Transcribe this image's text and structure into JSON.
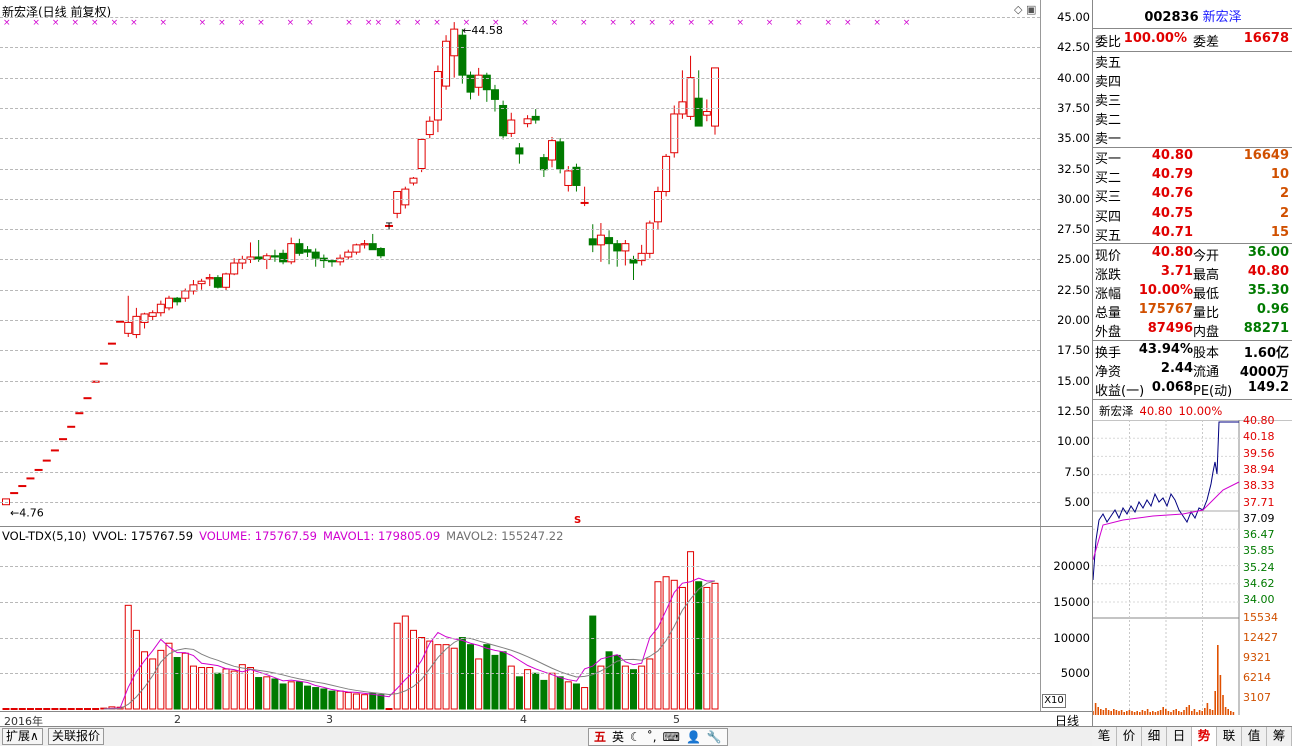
{
  "chart_header": {
    "title": "新宏泽(日线 前复权)"
  },
  "price_axis": {
    "labels": [
      "45.00",
      "42.50",
      "40.00",
      "37.50",
      "35.00",
      "32.50",
      "30.00",
      "27.50",
      "25.00",
      "22.50",
      "20.00",
      "17.50",
      "15.00",
      "12.50",
      "10.00",
      "7.50",
      "5.00"
    ]
  },
  "annotations": {
    "high_label": "44.58",
    "low_label": "4.76",
    "t_mark": "T",
    "s_mark": "S"
  },
  "volume_legend": {
    "name": "VOL-TDX(5,10)",
    "vvol": "VVOL: 175767.59",
    "volume": "VOLUME: 175767.59",
    "mavol1": "MAVOL1: 179805.09",
    "mavol2": "MAVOL2: 155247.22"
  },
  "volume_axis": {
    "labels": [
      "20000",
      "15000",
      "10000",
      "5000"
    ],
    "scale_label": "X10"
  },
  "x_axis": {
    "year_label": "2016年",
    "month_labels": [
      "2",
      "3",
      "4",
      "5"
    ],
    "period": "日线"
  },
  "colors": {
    "up": "#e00000",
    "down": "#007a00",
    "ma1": "#d000d0",
    "ma2": "#808080",
    "grid": "#b8b8b8",
    "avg_line": "#d000d0",
    "price_line": "#000080"
  },
  "chart_data": {
    "type": "candlestick",
    "price_range": [
      4.0,
      46.0
    ],
    "volume_range": [
      0,
      25000
    ],
    "candles": [
      {
        "o": 4.76,
        "h": 5.2,
        "l": 4.76,
        "c": 5.24,
        "v": 0
      },
      {
        "o": 5.76,
        "h": 5.76,
        "l": 5.76,
        "c": 5.76,
        "v": 0
      },
      {
        "o": 6.34,
        "h": 6.34,
        "l": 6.34,
        "c": 6.34,
        "v": 0
      },
      {
        "o": 6.97,
        "h": 6.97,
        "l": 6.97,
        "c": 6.97,
        "v": 0
      },
      {
        "o": 7.67,
        "h": 7.67,
        "l": 7.67,
        "c": 7.67,
        "v": 0
      },
      {
        "o": 8.44,
        "h": 8.44,
        "l": 8.44,
        "c": 8.44,
        "v": 0
      },
      {
        "o": 9.28,
        "h": 9.28,
        "l": 9.28,
        "c": 9.28,
        "v": 0
      },
      {
        "o": 10.21,
        "h": 10.21,
        "l": 10.21,
        "c": 10.21,
        "v": 0
      },
      {
        "o": 11.23,
        "h": 11.23,
        "l": 11.23,
        "c": 11.23,
        "v": 0
      },
      {
        "o": 12.35,
        "h": 12.35,
        "l": 12.35,
        "c": 12.35,
        "v": 0
      },
      {
        "o": 13.59,
        "h": 13.59,
        "l": 13.59,
        "c": 13.59,
        "v": 0
      },
      {
        "o": 14.95,
        "h": 14.95,
        "l": 14.95,
        "c": 14.95,
        "v": 0
      },
      {
        "o": 16.44,
        "h": 16.44,
        "l": 16.44,
        "c": 16.44,
        "v": 120
      },
      {
        "o": 18.09,
        "h": 18.09,
        "l": 18.09,
        "c": 18.09,
        "v": 300
      },
      {
        "o": 19.9,
        "h": 19.9,
        "l": 19.9,
        "c": 19.9,
        "v": 250
      },
      {
        "o": 18.9,
        "h": 22.0,
        "l": 18.6,
        "c": 19.8,
        "v": 14500
      },
      {
        "o": 18.8,
        "h": 21.0,
        "l": 18.5,
        "c": 20.3,
        "v": 11000
      },
      {
        "o": 19.8,
        "h": 20.6,
        "l": 19.3,
        "c": 20.5,
        "v": 8000
      },
      {
        "o": 20.3,
        "h": 20.8,
        "l": 20.0,
        "c": 20.6,
        "v": 7000
      },
      {
        "o": 20.6,
        "h": 21.6,
        "l": 20.3,
        "c": 21.3,
        "v": 8200
      },
      {
        "o": 21.0,
        "h": 22.0,
        "l": 20.8,
        "c": 21.8,
        "v": 9200
      },
      {
        "o": 21.8,
        "h": 21.9,
        "l": 21.2,
        "c": 21.5,
        "v": 7200
      },
      {
        "o": 21.8,
        "h": 22.6,
        "l": 21.5,
        "c": 22.4,
        "v": 7800
      },
      {
        "o": 22.4,
        "h": 23.3,
        "l": 22.1,
        "c": 22.9,
        "v": 6000
      },
      {
        "o": 23.0,
        "h": 23.4,
        "l": 22.5,
        "c": 23.2,
        "v": 5800
      },
      {
        "o": 23.4,
        "h": 23.8,
        "l": 22.8,
        "c": 23.5,
        "v": 5800
      },
      {
        "o": 23.5,
        "h": 23.7,
        "l": 22.6,
        "c": 22.7,
        "v": 5000
      },
      {
        "o": 22.7,
        "h": 23.9,
        "l": 22.4,
        "c": 23.8,
        "v": 5600
      },
      {
        "o": 23.8,
        "h": 25.1,
        "l": 23.7,
        "c": 24.7,
        "v": 5300
      },
      {
        "o": 24.7,
        "h": 25.3,
        "l": 24.2,
        "c": 25.0,
        "v": 6200
      },
      {
        "o": 25.0,
        "h": 26.4,
        "l": 24.7,
        "c": 25.2,
        "v": 5800
      },
      {
        "o": 25.2,
        "h": 26.6,
        "l": 24.8,
        "c": 25.0,
        "v": 4400
      },
      {
        "o": 25.0,
        "h": 25.5,
        "l": 24.2,
        "c": 25.3,
        "v": 4500
      },
      {
        "o": 25.3,
        "h": 25.8,
        "l": 24.8,
        "c": 25.2,
        "v": 4200
      },
      {
        "o": 25.5,
        "h": 25.8,
        "l": 24.6,
        "c": 24.8,
        "v": 3500
      },
      {
        "o": 24.8,
        "h": 26.8,
        "l": 24.6,
        "c": 26.3,
        "v": 3800
      },
      {
        "o": 26.3,
        "h": 26.7,
        "l": 25.3,
        "c": 25.5,
        "v": 3800
      },
      {
        "o": 25.8,
        "h": 26.1,
        "l": 25.2,
        "c": 25.6,
        "v": 3200
      },
      {
        "o": 25.6,
        "h": 25.9,
        "l": 24.4,
        "c": 25.1,
        "v": 3000
      },
      {
        "o": 25.1,
        "h": 25.4,
        "l": 24.3,
        "c": 24.9,
        "v": 2800
      },
      {
        "o": 24.9,
        "h": 25.0,
        "l": 24.4,
        "c": 24.8,
        "v": 2500
      },
      {
        "o": 24.8,
        "h": 25.4,
        "l": 24.5,
        "c": 25.1,
        "v": 2500
      },
      {
        "o": 25.2,
        "h": 25.8,
        "l": 25.0,
        "c": 25.6,
        "v": 2300
      },
      {
        "o": 25.6,
        "h": 26.3,
        "l": 25.4,
        "c": 26.2,
        "v": 2100
      },
      {
        "o": 26.2,
        "h": 26.6,
        "l": 25.9,
        "c": 26.3,
        "v": 2000
      },
      {
        "o": 26.3,
        "h": 27.1,
        "l": 25.8,
        "c": 25.8,
        "v": 2200
      },
      {
        "o": 25.9,
        "h": 26.0,
        "l": 25.1,
        "c": 25.3,
        "v": 2000
      },
      {
        "o": 27.8,
        "h": 27.8,
        "l": 27.8,
        "c": 27.8,
        "v": 0
      },
      {
        "o": 28.8,
        "h": 30.6,
        "l": 28.4,
        "c": 30.6,
        "v": 12000
      },
      {
        "o": 29.5,
        "h": 31.0,
        "l": 29.2,
        "c": 30.8,
        "v": 13000
      },
      {
        "o": 31.3,
        "h": 31.8,
        "l": 31.1,
        "c": 31.7,
        "v": 11000
      },
      {
        "o": 32.5,
        "h": 35.0,
        "l": 32.2,
        "c": 34.9,
        "v": 10000
      },
      {
        "o": 35.3,
        "h": 36.8,
        "l": 35.0,
        "c": 36.4,
        "v": 9500
      },
      {
        "o": 36.5,
        "h": 41.0,
        "l": 35.5,
        "c": 40.5,
        "v": 9000
      },
      {
        "o": 39.3,
        "h": 43.5,
        "l": 39.0,
        "c": 43.0,
        "v": 9000
      },
      {
        "o": 41.8,
        "h": 44.58,
        "l": 40.0,
        "c": 44.0,
        "v": 8500
      },
      {
        "o": 43.5,
        "h": 44.0,
        "l": 39.5,
        "c": 40.2,
        "v": 10000
      },
      {
        "o": 40.2,
        "h": 40.5,
        "l": 38.2,
        "c": 38.8,
        "v": 9000
      },
      {
        "o": 39.2,
        "h": 40.8,
        "l": 38.5,
        "c": 40.2,
        "v": 7000
      },
      {
        "o": 40.2,
        "h": 40.4,
        "l": 38.0,
        "c": 39.0,
        "v": 9000
      },
      {
        "o": 39.0,
        "h": 39.4,
        "l": 37.2,
        "c": 38.2,
        "v": 7500
      },
      {
        "o": 37.7,
        "h": 38.1,
        "l": 34.9,
        "c": 35.2,
        "v": 8000
      },
      {
        "o": 35.4,
        "h": 37.1,
        "l": 35.1,
        "c": 36.5,
        "v": 6000
      },
      {
        "o": 34.2,
        "h": 34.6,
        "l": 32.9,
        "c": 33.7,
        "v": 4500
      },
      {
        "o": 36.2,
        "h": 36.9,
        "l": 35.9,
        "c": 36.6,
        "v": 5500
      },
      {
        "o": 36.8,
        "h": 37.4,
        "l": 36.2,
        "c": 36.5,
        "v": 5000
      },
      {
        "o": 33.4,
        "h": 33.7,
        "l": 31.8,
        "c": 32.4,
        "v": 4000
      },
      {
        "o": 33.2,
        "h": 35.1,
        "l": 32.6,
        "c": 34.8,
        "v": 5000
      },
      {
        "o": 34.7,
        "h": 35.0,
        "l": 32.1,
        "c": 32.5,
        "v": 4500
      },
      {
        "o": 31.1,
        "h": 32.7,
        "l": 30.6,
        "c": 32.3,
        "v": 3800
      },
      {
        "o": 32.6,
        "h": 32.9,
        "l": 30.6,
        "c": 31.1,
        "v": 3500
      },
      {
        "o": 29.7,
        "h": 31.0,
        "l": 29.4,
        "c": 29.7,
        "v": 3000
      },
      {
        "o": 26.7,
        "h": 27.9,
        "l": 25.6,
        "c": 26.2,
        "v": 13000
      },
      {
        "o": 26.2,
        "h": 28.0,
        "l": 24.8,
        "c": 27.0,
        "v": 6000
      },
      {
        "o": 26.8,
        "h": 27.4,
        "l": 24.6,
        "c": 26.3,
        "v": 8000
      },
      {
        "o": 26.3,
        "h": 26.6,
        "l": 24.4,
        "c": 25.7,
        "v": 7500
      },
      {
        "o": 25.7,
        "h": 26.6,
        "l": 24.5,
        "c": 26.3,
        "v": 6000
      },
      {
        "o": 25.0,
        "h": 25.3,
        "l": 23.3,
        "c": 24.7,
        "v": 5500
      },
      {
        "o": 24.9,
        "h": 26.2,
        "l": 24.5,
        "c": 25.5,
        "v": 6000
      },
      {
        "o": 25.5,
        "h": 28.2,
        "l": 25.1,
        "c": 28.0,
        "v": 7000
      },
      {
        "o": 28.1,
        "h": 31.0,
        "l": 27.5,
        "c": 30.6,
        "v": 17800
      },
      {
        "o": 30.6,
        "h": 33.7,
        "l": 30.2,
        "c": 33.5,
        "v": 18500
      },
      {
        "o": 33.8,
        "h": 37.7,
        "l": 33.4,
        "c": 37.0,
        "v": 18000
      },
      {
        "o": 37.0,
        "h": 40.6,
        "l": 36.6,
        "c": 38.0,
        "v": 17000
      },
      {
        "o": 36.8,
        "h": 41.8,
        "l": 36.5,
        "c": 40.0,
        "v": 22000
      },
      {
        "o": 38.3,
        "h": 40.6,
        "l": 36.0,
        "c": 36.0,
        "v": 17800
      },
      {
        "o": 36.9,
        "h": 38.2,
        "l": 36.4,
        "c": 37.2,
        "v": 17000
      },
      {
        "o": 36.0,
        "h": 40.8,
        "l": 35.3,
        "c": 40.8,
        "v": 17576
      }
    ],
    "ma1": [
      0,
      0,
      0,
      0,
      0,
      0,
      0,
      0,
      0,
      0,
      0,
      0,
      24,
      84,
      134,
      3034,
      5214,
      6750,
      8150,
      9740,
      8680,
      7880,
      7880,
      7480,
      6400,
      6240,
      6060,
      5640,
      5500,
      5200,
      5520,
      5180,
      4800,
      4380,
      3940,
      4040,
      3880,
      3700,
      3280,
      3020,
      2720,
      2540,
      2380,
      2320,
      2180,
      2060,
      1880,
      1720,
      2880,
      4120,
      5160,
      6800,
      9200,
      10700,
      10100,
      9800,
      9600,
      9200,
      8900,
      8500,
      8200,
      8000,
      7500,
      6800,
      6100,
      5600,
      5200,
      4800,
      4400,
      4100,
      3900,
      5600,
      6000,
      7000,
      7300,
      7600,
      6600,
      6200,
      6400,
      10000,
      11400,
      13800,
      16300,
      17600,
      17800,
      18300,
      17900,
      17900
    ]
  },
  "markers": {
    "t_index": 47,
    "top_marks": [
      0,
      3,
      5,
      7,
      9,
      11,
      13,
      16,
      20,
      22,
      24,
      26,
      29,
      31,
      35,
      37,
      38,
      40,
      42,
      44,
      47,
      50,
      53,
      56,
      59,
      62,
      64,
      66,
      68,
      70,
      72,
      75,
      78,
      81,
      84,
      86,
      89,
      92
    ],
    "top_marks_px": []
  },
  "side": {
    "code": "002836",
    "name": "新宏泽",
    "weibi_label": "委比",
    "weibi": "100.00%",
    "weicha_label": "委差",
    "weicha": "16678",
    "sell": [
      {
        "label": "卖五",
        "price": "",
        "vol": ""
      },
      {
        "label": "卖四",
        "price": "",
        "vol": ""
      },
      {
        "label": "卖三",
        "price": "",
        "vol": ""
      },
      {
        "label": "卖二",
        "price": "",
        "vol": ""
      },
      {
        "label": "卖一",
        "price": "",
        "vol": ""
      }
    ],
    "buy": [
      {
        "label": "买一",
        "price": "40.80",
        "vol": "16649"
      },
      {
        "label": "买二",
        "price": "40.79",
        "vol": "10"
      },
      {
        "label": "买三",
        "price": "40.76",
        "vol": "2"
      },
      {
        "label": "买四",
        "price": "40.75",
        "vol": "2"
      },
      {
        "label": "买五",
        "price": "40.71",
        "vol": "15"
      }
    ],
    "quote": [
      {
        "l1": "现价",
        "v1": "40.80",
        "c1": "red",
        "l2": "今开",
        "v2": "36.00",
        "c2": "grn"
      },
      {
        "l1": "涨跌",
        "v1": "3.71",
        "c1": "red",
        "l2": "最高",
        "v2": "40.80",
        "c2": "red"
      },
      {
        "l1": "涨幅",
        "v1": "10.00%",
        "c1": "red",
        "l2": "最低",
        "v2": "35.30",
        "c2": "grn"
      },
      {
        "l1": "总量",
        "v1": "175767",
        "c1": "org",
        "l2": "量比",
        "v2": "0.96",
        "c2": "grn"
      },
      {
        "l1": "外盘",
        "v1": "87496",
        "c1": "red",
        "l2": "内盘",
        "v2": "88271",
        "c2": "grn"
      }
    ],
    "fund": [
      {
        "l1": "换手",
        "v1": "43.94%",
        "l2": "股本",
        "v2": "1.60亿"
      },
      {
        "l1": "净资",
        "v1": "2.44",
        "l2": "流通",
        "v2": "4000万"
      },
      {
        "l1": "收益(一)",
        "v1": "0.068",
        "l2": "PE(动)",
        "v2": "149.2"
      }
    ],
    "mini": {
      "name": "新宏泽",
      "price": "40.80",
      "pct": "10.00%",
      "price_labels": [
        "40.80",
        "40.18",
        "39.56",
        "38.94",
        "38.33",
        "37.71",
        "37.09",
        "36.47",
        "35.85",
        "35.24",
        "34.62",
        "34.00"
      ],
      "vol_labels": [
        "15534",
        "12427",
        "9321",
        "6214",
        "3107"
      ]
    },
    "tabs": [
      "笔",
      "价",
      "细",
      "日",
      "势",
      "联",
      "值",
      "筹"
    ],
    "active_tab": "势"
  },
  "bottom_tabs": [
    "扩展∧",
    "关联报价"
  ],
  "ime": [
    "五",
    "英",
    "☾",
    "˚,",
    "⌨",
    "👤",
    "🔧"
  ]
}
